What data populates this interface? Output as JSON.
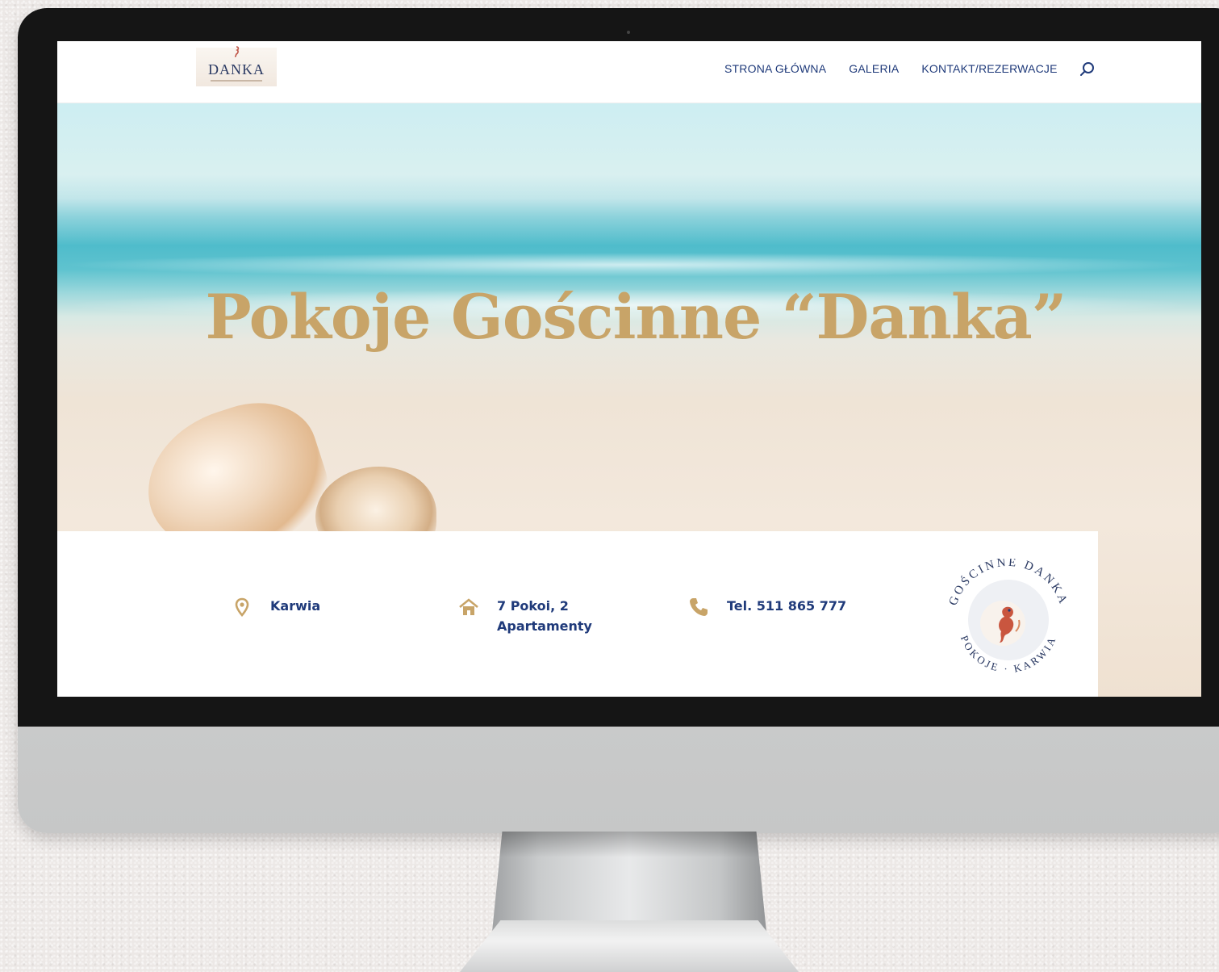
{
  "brand": {
    "logo_text": "DANKA",
    "accent_gold": "#c8a468",
    "navy": "#1f3a7a"
  },
  "nav": {
    "items": [
      {
        "label": "STRONA GŁÓWNA"
      },
      {
        "label": "GALERIA"
      },
      {
        "label": "KONTAKT/REZERWACJE"
      }
    ],
    "search_icon": "search-icon"
  },
  "hero": {
    "title": "Pokoje Gościnne “Danka”"
  },
  "info": {
    "location": {
      "icon": "map-pin-icon",
      "text": "Karwia"
    },
    "rooms": {
      "icon": "house-icon",
      "line1": "7 Pokoi, 2",
      "line2": "Apartamenty"
    },
    "phone": {
      "icon": "phone-icon",
      "text": "Tel. 511 865 777"
    },
    "badge": {
      "top_text": "GOŚCINNE DANKA",
      "bottom_text": "POKOJE · KARWIA",
      "icon": "seahorse-icon"
    }
  }
}
